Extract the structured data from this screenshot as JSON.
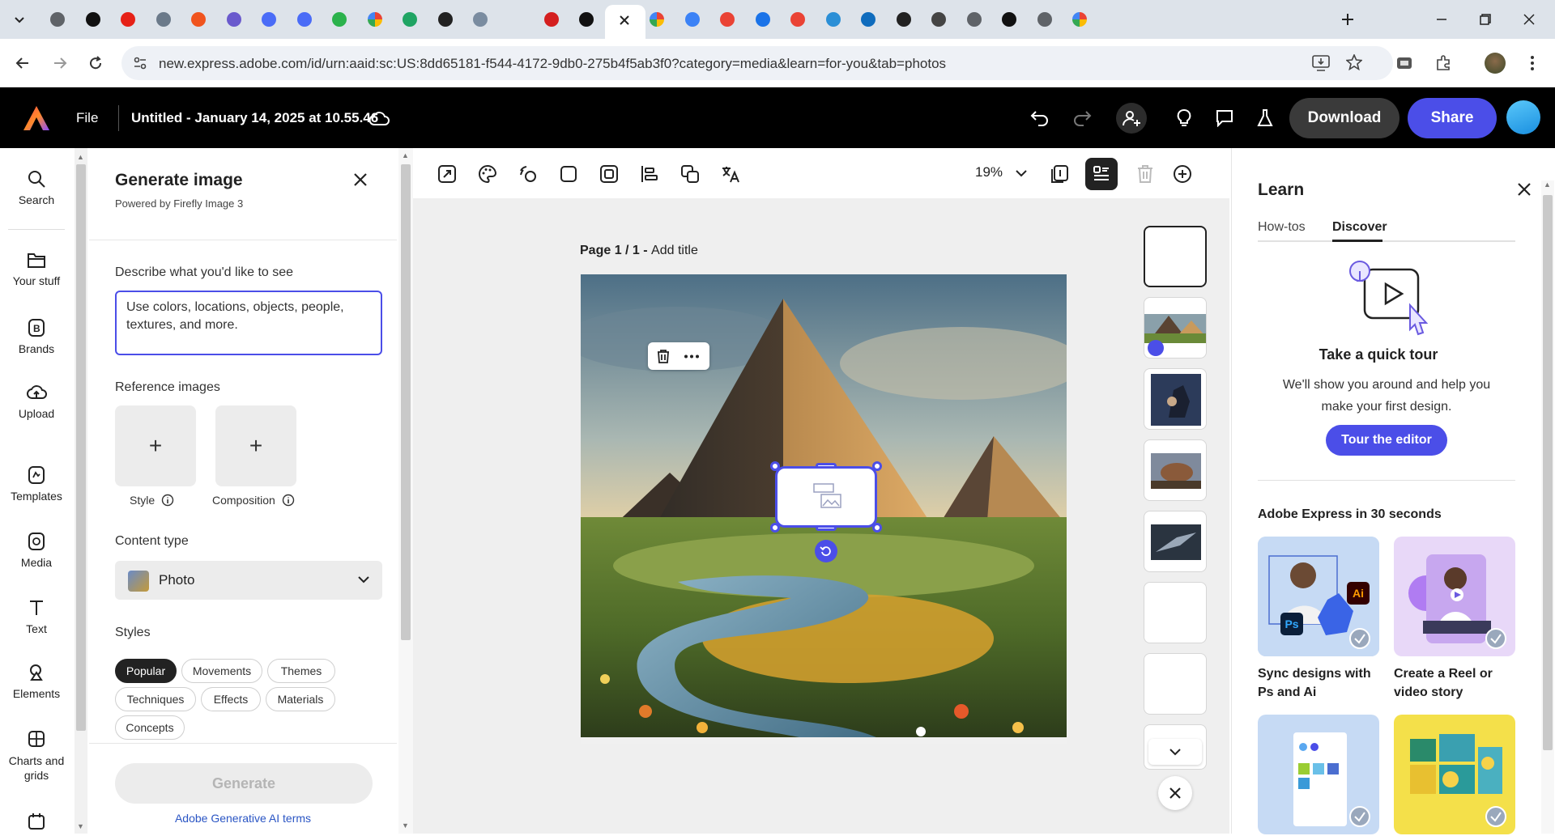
{
  "browser": {
    "url": "new.express.adobe.com/id/urn:aaid:sc:US:8dd65181-f544-4172-9db0-275b4f5ab3f0?category=media&learn=for-you&tab=photos",
    "tab_icons": [
      "chrome",
      "notion",
      "youtube",
      "doc",
      "audio",
      "chat",
      "meet",
      "meet",
      "feedly",
      "google",
      "drive",
      "pen",
      "analytics",
      "adobe-active",
      "acrobat",
      "threads",
      "google",
      "google",
      "gemini",
      "gmail",
      "doc-blue",
      "gmail",
      "edge",
      "outlook",
      "medium",
      "wikipedia",
      "chrome",
      "amazon",
      "chrome",
      "google"
    ]
  },
  "header": {
    "file_label": "File",
    "doc_title": "Untitled - January 14, 2025 at 10.55.46",
    "download_label": "Download",
    "share_label": "Share"
  },
  "rail": {
    "search": "Search",
    "your_stuff": "Your stuff",
    "brands": "Brands",
    "upload": "Upload",
    "templates": "Templates",
    "media": "Media",
    "text": "Text",
    "elements": "Elements",
    "charts": "Charts and grids"
  },
  "generate": {
    "title": "Generate image",
    "subtitle": "Powered by Firefly Image 3",
    "describe_label": "Describe what you'd like to see",
    "prompt_placeholder": "Use colors, locations, objects, people, textures, and more.",
    "reference_label": "Reference images",
    "style_label": "Style",
    "composition_label": "Composition",
    "content_type_label": "Content type",
    "content_type_value": "Photo",
    "styles_label": "Styles",
    "style_chips": [
      "Popular",
      "Movements",
      "Themes",
      "Techniques",
      "Effects",
      "Materials",
      "Concepts"
    ],
    "generate_button": "Generate",
    "terms_link": "Adobe Generative AI terms"
  },
  "canvas": {
    "zoom": "19%",
    "page_label": "Page 1 / 1 - ",
    "add_title": "Add title"
  },
  "learn": {
    "title": "Learn",
    "tab_howtos": "How-tos",
    "tab_discover": "Discover",
    "tour_title": "Take a quick tour",
    "tour_desc": "We'll show you around and help you make your first design.",
    "tour_button": "Tour the editor",
    "section_title": "Adobe Express in 30 seconds",
    "card1_title": "Sync designs with Ps and Ai",
    "card2_title": "Create a Reel or video story",
    "ps_badge": "Ps",
    "ai_badge": "Ai"
  }
}
